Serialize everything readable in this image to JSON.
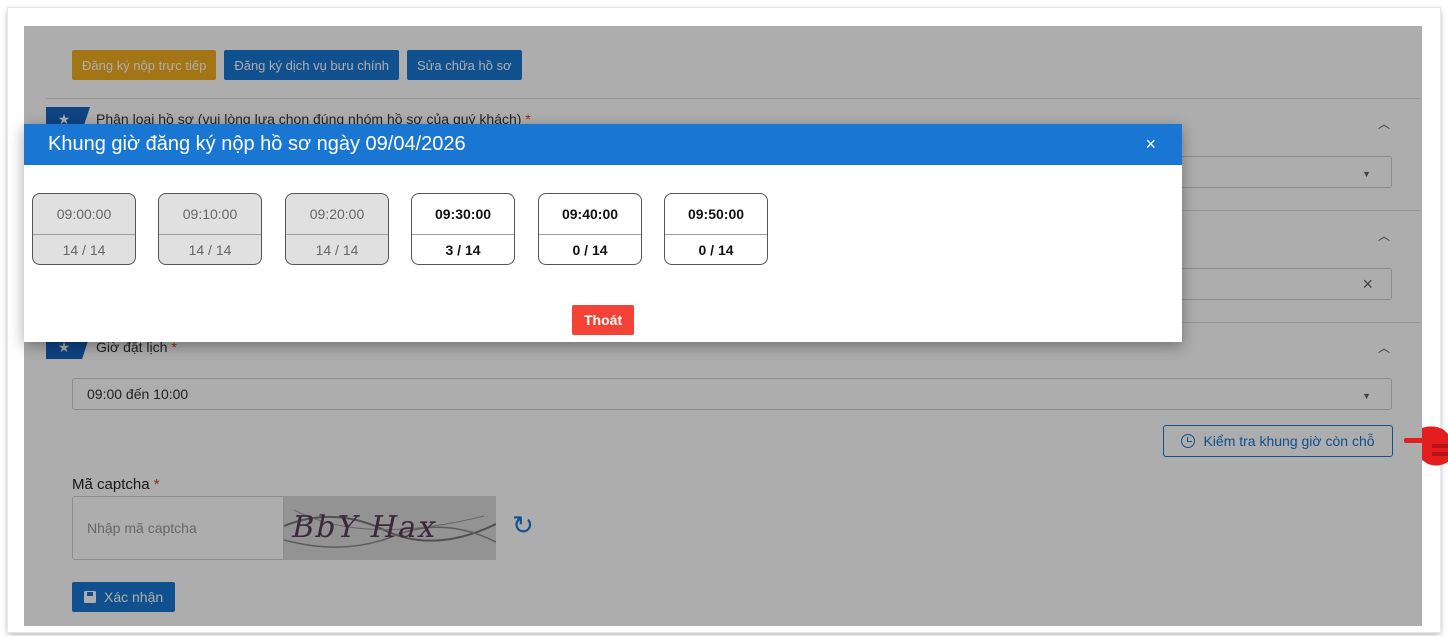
{
  "top_buttons": {
    "direct": "Đăng ký nộp trực tiếp",
    "postal": "Đăng ký dịch vụ bưu chính",
    "edit": "Sửa chữa hồ sơ"
  },
  "sections": {
    "category_label": "Phân loại hồ sơ (vui lòng lựa chọn đúng nhóm hồ sơ của quý khách)",
    "time_label": "Giờ đặt lịch",
    "required_mark": "*",
    "time_value": "09:00 đến 10:00"
  },
  "check_slots_label": "Kiểm tra khung giờ còn chỗ",
  "captcha": {
    "label": "Mã captcha",
    "placeholder": "Nhập mã captcha",
    "text": "BbY Hax"
  },
  "confirm_label": "Xác nhận",
  "modal": {
    "title": "Khung giờ đăng ký nộp hồ sơ ngày 09/04/2026",
    "close": "×",
    "exit_label": "Thoát",
    "slots": [
      {
        "time": "09:00:00",
        "count": "14 / 14"
      },
      {
        "time": "09:10:00",
        "count": "14 / 14"
      },
      {
        "time": "09:20:00",
        "count": "14 / 14"
      },
      {
        "time": "09:30:00",
        "count": "3 / 14"
      },
      {
        "time": "09:40:00",
        "count": "0 / 14"
      },
      {
        "time": "09:50:00",
        "count": "0 / 14"
      }
    ]
  },
  "colors": {
    "primary": "#1976d2",
    "warning": "#f0ad20",
    "danger": "#f44336",
    "arrow": "#e41e1e"
  },
  "icons": {
    "star": "star-icon",
    "chevron": "chevron-up-icon",
    "caret": "caret-down-icon",
    "clear": "close-icon",
    "clock": "clock-icon",
    "refresh": "refresh-icon",
    "save": "floppy-icon",
    "pointer": "hand-pointer-icon"
  }
}
